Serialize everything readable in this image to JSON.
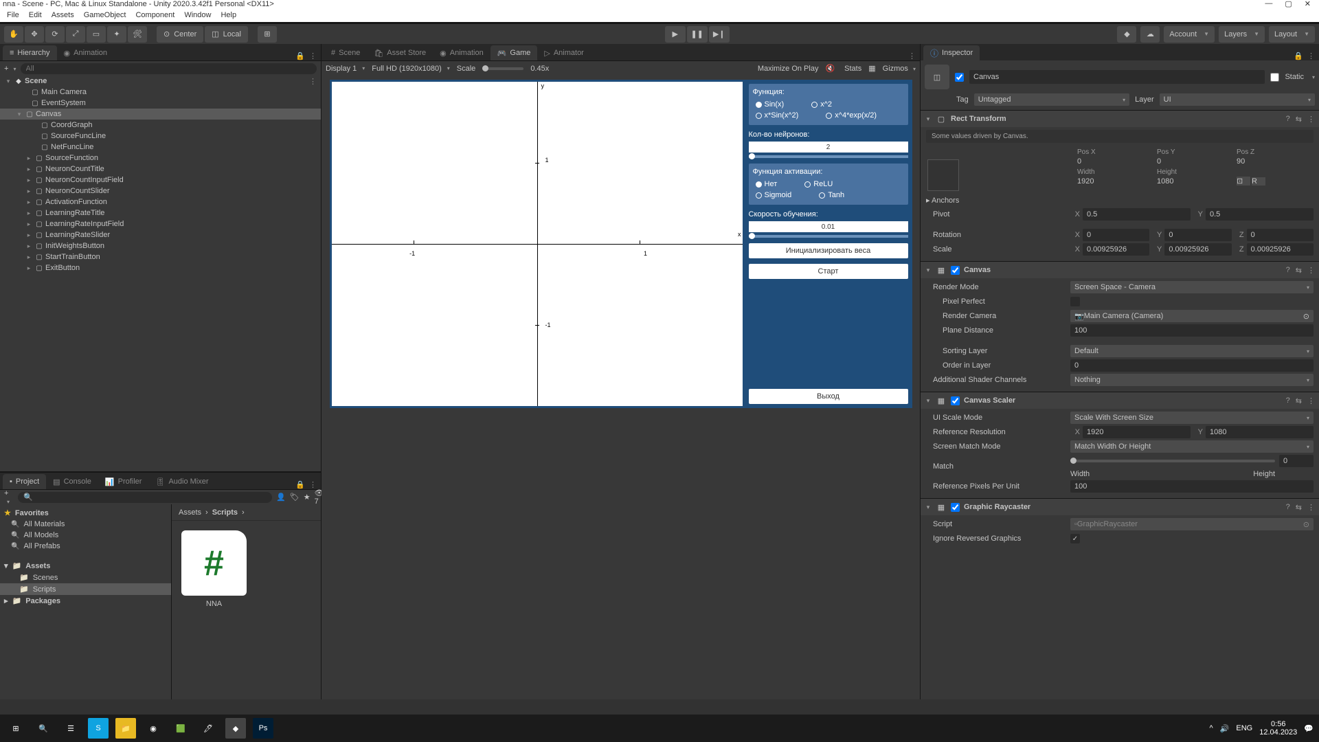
{
  "window_title": "nna - Scene - PC, Mac & Linux Standalone - Unity 2020.3.42f1 Personal <DX11>",
  "menu": [
    "File",
    "Edit",
    "Assets",
    "GameObject",
    "Component",
    "Window",
    "Help"
  ],
  "toolbar": {
    "center": "Center",
    "local": "Local",
    "account": "Account",
    "layers": "Layers",
    "layout": "Layout"
  },
  "panels": {
    "hierarchy": {
      "title": "Hierarchy",
      "animation_tab": "Animation",
      "search_ph": "All"
    },
    "project": {
      "title": "Project",
      "console": "Console",
      "profiler": "Profiler",
      "audiomixer": "Audio Mixer"
    },
    "inspector": {
      "title": "Inspector"
    }
  },
  "hierarchy": {
    "scene": "Scene",
    "items": [
      "Main Camera",
      "EventSystem",
      "Canvas",
      "CoordGraph",
      "SourceFuncLine",
      "NetFuncLine",
      "SourceFunction",
      "NeuronCountTitle",
      "NeuronCountInputField",
      "NeuronCountSlider",
      "ActivationFunction",
      "LearningRateTitle",
      "LearningRateInputField",
      "LearningRateSlider",
      "InitWeightsButton",
      "StartTrainButton",
      "ExitButton"
    ]
  },
  "project": {
    "favorites": "Favorites",
    "fav_items": [
      "All Materials",
      "All Models",
      "All Prefabs"
    ],
    "assets": "Assets",
    "asset_folders": [
      "Scenes",
      "Scripts"
    ],
    "packages": "Packages",
    "breadcrumb": [
      "Assets",
      "Scripts"
    ],
    "file_name": "NNA",
    "count_badge": "7"
  },
  "scene_tabs": {
    "scene": "Scene",
    "asset_store": "Asset Store",
    "animation": "Animation",
    "game": "Game",
    "animator": "Animator"
  },
  "game_toolbar": {
    "display": "Display 1",
    "resolution": "Full HD (1920x1080)",
    "scale_label": "Scale",
    "scale_value": "0.45x",
    "max_on_play": "Maximize On Play",
    "stats": "Stats",
    "gizmos": "Gizmos"
  },
  "game_ui": {
    "func_title": "Функция:",
    "func_opts": [
      "Sin(x)",
      "x^2",
      "x*Sin(x^2)",
      "x^4*exp(x/2)"
    ],
    "neuron_title": "Кол-во нейронов:",
    "neuron_val": "2",
    "act_title": "Функция активации:",
    "act_opts": [
      "Нет",
      "ReLU",
      "Sigmoid",
      "Tanh"
    ],
    "lr_title": "Скорость обучения:",
    "lr_val": "0.01",
    "init_btn": "Инициализировать веса",
    "start_btn": "Старт",
    "exit_btn": "Выход",
    "axis_ticks": {
      "y1": "1",
      "ym1": "-1",
      "x1": "1",
      "xm1": "-1",
      "xlabel": "x",
      "ylabel": "y"
    }
  },
  "inspector": {
    "obj_name": "Canvas",
    "static": "Static",
    "tag_label": "Tag",
    "tag_value": "Untagged",
    "layer_label": "Layer",
    "layer_value": "UI",
    "rect": {
      "title": "Rect Transform",
      "help": "Some values driven by Canvas.",
      "posx": "Pos X",
      "posy": "Pos Y",
      "posz": "Pos Z",
      "posxv": "0",
      "posyv": "0",
      "poszv": "90",
      "width": "Width",
      "height": "Height",
      "widthv": "1920",
      "heightv": "1080",
      "anchors": "Anchors",
      "pivot": "Pivot",
      "pivxv": "0.5",
      "pivyv": "0.5",
      "rotation": "Rotation",
      "rxv": "0",
      "ryv": "0",
      "rzv": "0",
      "scale": "Scale",
      "sxv": "0.00925926",
      "syv": "0.00925926",
      "szv": "0.00925926",
      "r_btn": "R"
    },
    "canvas": {
      "title": "Canvas",
      "render_mode": "Render Mode",
      "render_mode_v": "Screen Space - Camera",
      "pixel_perfect": "Pixel Perfect",
      "render_camera": "Render Camera",
      "render_camera_v": "Main Camera (Camera)",
      "plane_distance": "Plane Distance",
      "plane_distance_v": "100",
      "sorting_layer": "Sorting Layer",
      "sorting_layer_v": "Default",
      "order": "Order in Layer",
      "order_v": "0",
      "shader_ch": "Additional Shader Channels",
      "shader_ch_v": "Nothing"
    },
    "scaler": {
      "title": "Canvas Scaler",
      "mode": "UI Scale Mode",
      "mode_v": "Scale With Screen Size",
      "ref_res": "Reference Resolution",
      "ref_x": "1920",
      "ref_y": "1080",
      "match_mode": "Screen Match Mode",
      "match_mode_v": "Match Width Or Height",
      "match": "Match",
      "match_v": "0",
      "match_w": "Width",
      "match_h": "Height",
      "ref_px": "Reference Pixels Per Unit",
      "ref_px_v": "100"
    },
    "raycaster": {
      "title": "Graphic Raycaster",
      "script": "Script",
      "script_v": "GraphicRaycaster",
      "ignore": "Ignore Reversed Graphics"
    }
  },
  "taskbar": {
    "lang": "ENG",
    "time": "0:56",
    "date": "12.04.2023"
  }
}
